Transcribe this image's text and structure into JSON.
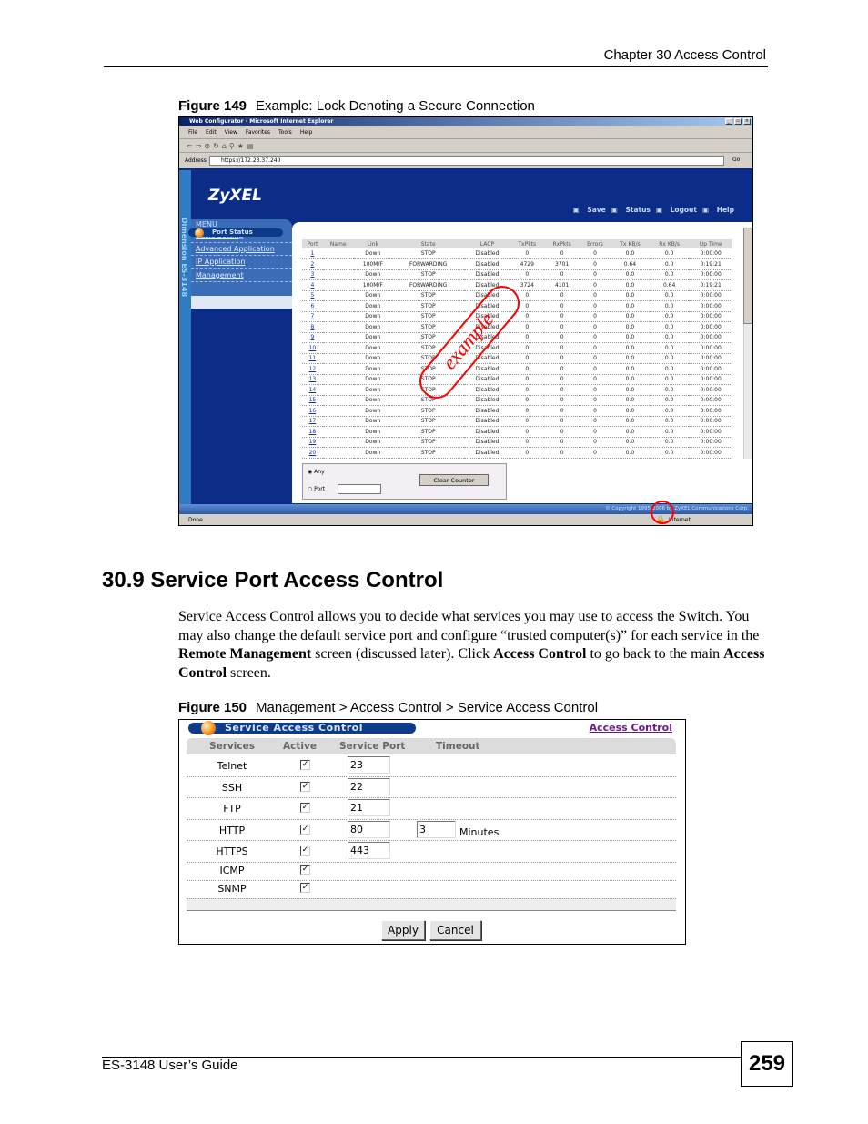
{
  "header": {
    "chapter": "Chapter 30 Access Control"
  },
  "figure149": {
    "label": "Figure 149",
    "caption": "Example: Lock Denoting a Secure Connection",
    "browser": {
      "title": "Web Configurator - Microsoft Internet Explorer",
      "menu": [
        "File",
        "Edit",
        "View",
        "Favorites",
        "Tools",
        "Help"
      ],
      "address_label": "Address",
      "address": "https://172.23.37.240",
      "go": "Go",
      "status_done": "Done",
      "status_zone": "Internet",
      "window_buttons": [
        "_",
        "▫",
        "×"
      ]
    },
    "app": {
      "logo": "ZyXEL",
      "side_label": "Dimension  ES-3148",
      "top_links": [
        "Save",
        "Status",
        "Logout",
        "Help"
      ],
      "menu_title": "MENU",
      "menu_items": [
        "Basic Setting",
        "Advanced Application",
        "IP Application",
        "Management"
      ],
      "panel_title": "Port Status",
      "columns": [
        "Port",
        "Name",
        "Link",
        "State",
        "LACP",
        "TxPkts",
        "RxPkts",
        "Errors",
        "Tx KB/s",
        "Rx KB/s",
        "Up Time"
      ],
      "rows": [
        [
          "1",
          "",
          "Down",
          "STOP",
          "Disabled",
          "0",
          "0",
          "0",
          "0.0",
          "0.0",
          "0:00:00"
        ],
        [
          "2",
          "",
          "100M/F",
          "FORWARDING",
          "Disabled",
          "4729",
          "3701",
          "0",
          "0.64",
          "0.0",
          "0:19:21"
        ],
        [
          "3",
          "",
          "Down",
          "STOP",
          "Disabled",
          "0",
          "0",
          "0",
          "0.0",
          "0.0",
          "0:00:00"
        ],
        [
          "4",
          "",
          "100M/F",
          "FORWARDING",
          "Disabled",
          "3724",
          "4101",
          "0",
          "0.0",
          "0.64",
          "0:19:21"
        ],
        [
          "5",
          "",
          "Down",
          "STOP",
          "Disabled",
          "0",
          "0",
          "0",
          "0.0",
          "0.0",
          "0:00:00"
        ],
        [
          "6",
          "",
          "Down",
          "STOP",
          "Disabled",
          "0",
          "0",
          "0",
          "0.0",
          "0.0",
          "0:00:00"
        ],
        [
          "7",
          "",
          "Down",
          "STOP",
          "Disabled",
          "0",
          "0",
          "0",
          "0.0",
          "0.0",
          "0:00:00"
        ],
        [
          "8",
          "",
          "Down",
          "STOP",
          "Disabled",
          "0",
          "0",
          "0",
          "0.0",
          "0.0",
          "0:00:00"
        ],
        [
          "9",
          "",
          "Down",
          "STOP",
          "Disabled",
          "0",
          "0",
          "0",
          "0.0",
          "0.0",
          "0:00:00"
        ],
        [
          "10",
          "",
          "Down",
          "STOP",
          "Disabled",
          "0",
          "0",
          "0",
          "0.0",
          "0.0",
          "0:00:00"
        ],
        [
          "11",
          "",
          "Down",
          "STOP",
          "Disabled",
          "0",
          "0",
          "0",
          "0.0",
          "0.0",
          "0:00:00"
        ],
        [
          "12",
          "",
          "Down",
          "STOP",
          "Disabled",
          "0",
          "0",
          "0",
          "0.0",
          "0.0",
          "0:00:00"
        ],
        [
          "13",
          "",
          "Down",
          "STOP",
          "Disabled",
          "0",
          "0",
          "0",
          "0.0",
          "0.0",
          "0:00:00"
        ],
        [
          "14",
          "",
          "Down",
          "STOP",
          "Disabled",
          "0",
          "0",
          "0",
          "0.0",
          "0.0",
          "0:00:00"
        ],
        [
          "15",
          "",
          "Down",
          "STOP",
          "Disabled",
          "0",
          "0",
          "0",
          "0.0",
          "0.0",
          "0:00:00"
        ],
        [
          "16",
          "",
          "Down",
          "STOP",
          "Disabled",
          "0",
          "0",
          "0",
          "0.0",
          "0.0",
          "0:00:00"
        ],
        [
          "17",
          "",
          "Down",
          "STOP",
          "Disabled",
          "0",
          "0",
          "0",
          "0.0",
          "0.0",
          "0:00:00"
        ],
        [
          "18",
          "",
          "Down",
          "STOP",
          "Disabled",
          "0",
          "0",
          "0",
          "0.0",
          "0.0",
          "0:00:00"
        ],
        [
          "19",
          "",
          "Down",
          "STOP",
          "Disabled",
          "0",
          "0",
          "0",
          "0.0",
          "0.0",
          "0:00:00"
        ],
        [
          "20",
          "",
          "Down",
          "STOP",
          "Disabled",
          "0",
          "0",
          "0",
          "0.0",
          "0.0",
          "0:00:00"
        ]
      ],
      "radio_any": "Any",
      "radio_port": "Port",
      "port_value": "",
      "clear_button": "Clear Counter",
      "copyright": "© Copyright 1995-2006 by ZyXEL Communications Corp."
    },
    "stamp": "example"
  },
  "section": {
    "title": "30.9  Service Port Access Control"
  },
  "paragraph": [
    {
      "t": "Service Access Control allows you to decide what services you may use to access the Switch. You may also change the default service port and configure “trusted computer(s)” for each service in the "
    },
    {
      "b": "Remote Management"
    },
    {
      "t": " screen (discussed later). Click "
    },
    {
      "b": "Access Control"
    },
    {
      "t": " to go back to the main "
    },
    {
      "b": "Access Control"
    },
    {
      "t": " screen."
    }
  ],
  "figure150": {
    "label": "Figure 150",
    "caption": "Management > Access Control > Service Access Control",
    "title": "Service Access Control",
    "link": "Access Control",
    "columns": [
      "Services",
      "Active",
      "Service Port",
      "Timeout"
    ],
    "services": [
      {
        "name": "Telnet",
        "active": true,
        "port": "23"
      },
      {
        "name": "SSH",
        "active": true,
        "port": "22"
      },
      {
        "name": "FTP",
        "active": true,
        "port": "21"
      },
      {
        "name": "HTTP",
        "active": true,
        "port": "80",
        "timeout": "3",
        "unit": "Minutes"
      },
      {
        "name": "HTTPS",
        "active": true,
        "port": "443"
      },
      {
        "name": "ICMP",
        "active": true
      },
      {
        "name": "SNMP",
        "active": true
      }
    ],
    "apply": "Apply",
    "cancel": "Cancel"
  },
  "footer": {
    "guide": "ES-3148 User’s Guide",
    "page": "259"
  }
}
